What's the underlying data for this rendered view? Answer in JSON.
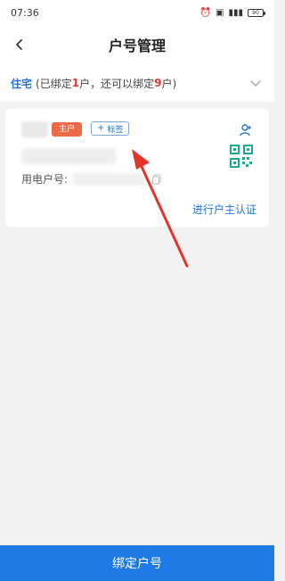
{
  "status_bar": {
    "time": "07:36",
    "battery": "90",
    "icons": [
      "alarm-icon",
      "nfc-icon",
      "signal-icon",
      "battery-icon"
    ]
  },
  "nav": {
    "title": "户号管理",
    "back_icon": "chevron-left-icon"
  },
  "category": {
    "type": "住宅",
    "part1": "(已绑定",
    "bound_count": "1",
    "part2": "户，还可以绑定",
    "remaining_count": "9",
    "part3": "户)",
    "expand_icon": "chevron-down-icon"
  },
  "account_card": {
    "owner_badge": "主户",
    "tag_button_label": "标签",
    "account_label": "用电户号:",
    "verify_label": "进行户主认证",
    "icons": {
      "user_add": "user-add-icon",
      "qr": "qr-code-icon",
      "copy": "copy-icon",
      "tag_plus": "plus-icon"
    }
  },
  "bottom": {
    "bind_button": "绑定户号"
  },
  "colors": {
    "brand_blue": "#1d7ae6",
    "link_blue": "#1f73d6",
    "highlight_red": "#e03b33",
    "badge_orange": "#ee6a45",
    "annotation_red": "#e3342b",
    "background": "#f2f2f2"
  }
}
